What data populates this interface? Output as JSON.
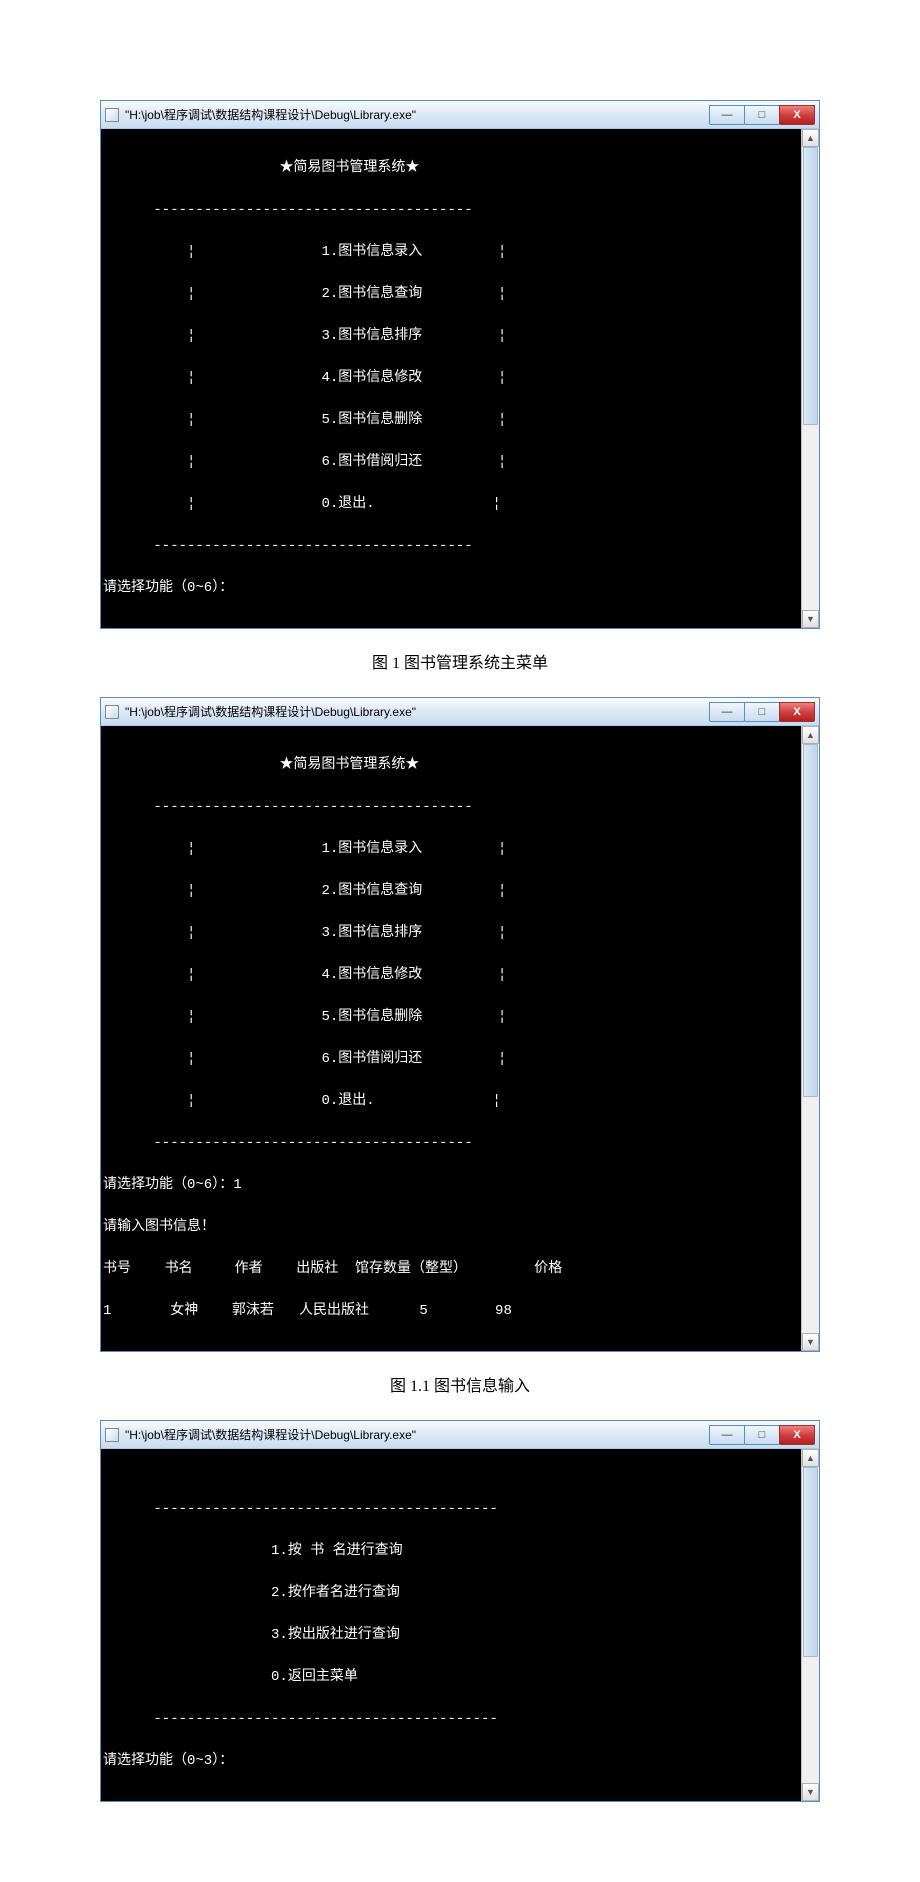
{
  "window_title": "\"H:\\job\\程序调试\\数据结构课程设计\\Debug\\Library.exe\"",
  "win_buttons": {
    "min": "—",
    "max": "□",
    "close": "X"
  },
  "scroll": {
    "up": "▲",
    "down": "▼"
  },
  "menu": {
    "header": "★简易图书管理系统★",
    "divider_top": "      --------------------------------------",
    "side_left": "     ¦",
    "side_right": "¦",
    "items": [
      "1.图书信息录入",
      "2.图书信息查询",
      "3.图书信息排序",
      "4.图书信息修改",
      "5.图书信息删除",
      "6.图书借阅归还",
      "0.退出."
    ],
    "divider_bot": "      --------------------------------------",
    "prompt_1": "请选择功能（0~6）：",
    "prompt_1_val": "请选择功能（0~6）：1",
    "input_header": "请输入图书信息！",
    "cols": "书号    书名     作者    出版社  馆存数量（整型）        价格",
    "row1": "1       女神    郭沫若   人民出版社      5        98"
  },
  "submenu": {
    "divider": "      -----------------------------------------",
    "items": [
      "1.按 书 名进行查询",
      "2.按作者名进行查询",
      "3.按出版社进行查询",
      "0.返回主菜单"
    ],
    "prompt": "请选择功能（0~3）："
  },
  "captions": {
    "fig1": "图 1   图书管理系统主菜单",
    "fig1_1": "图 1.1  图书信息输入"
  }
}
